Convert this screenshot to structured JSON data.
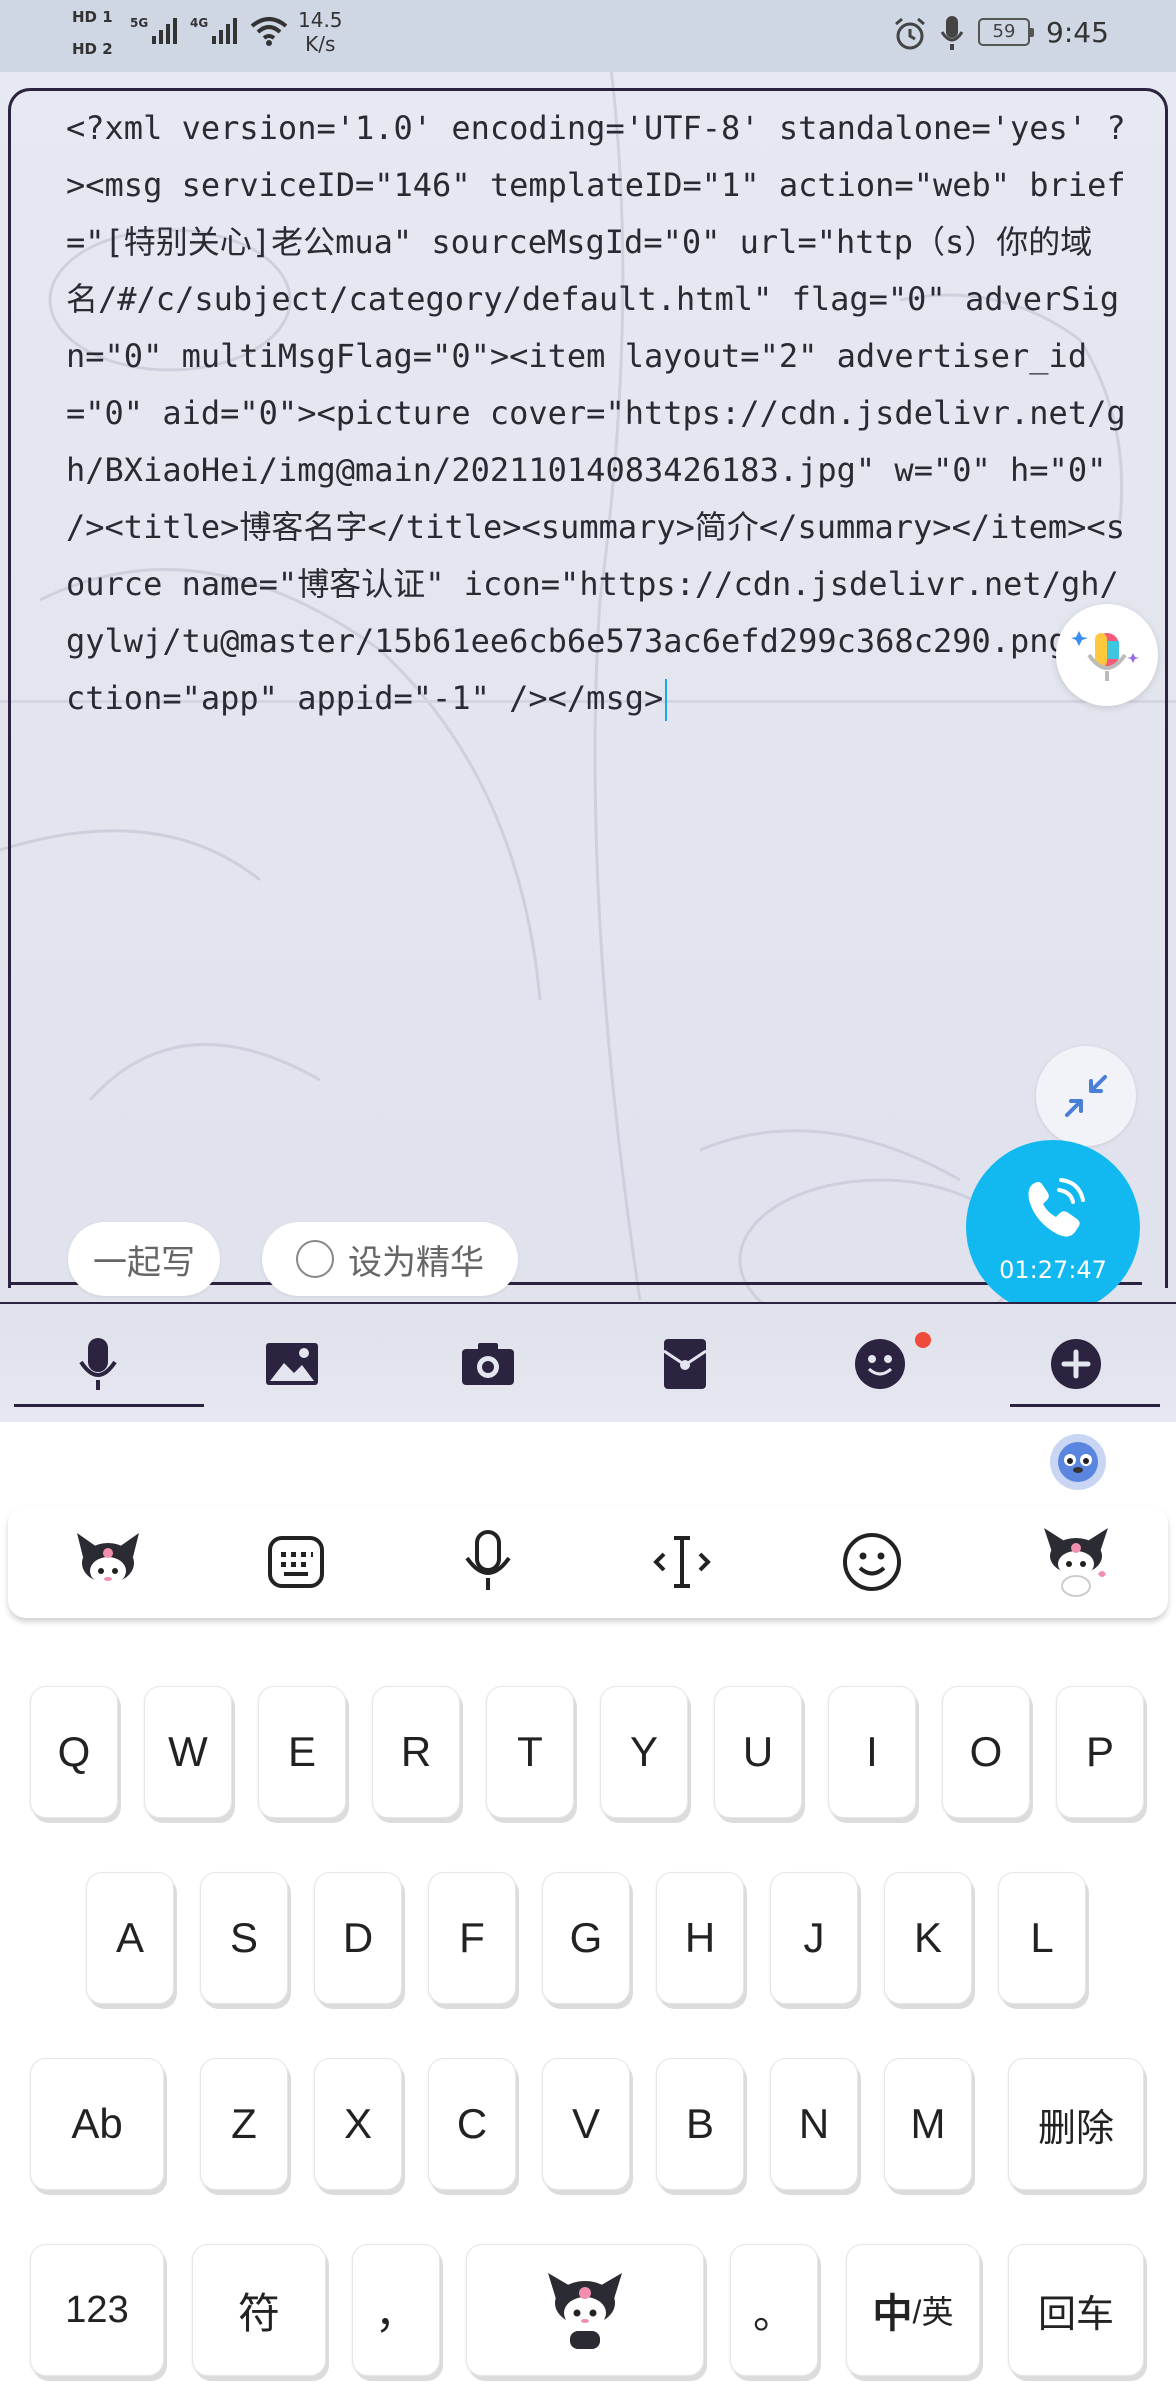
{
  "status_bar": {
    "hd1": "HD 1",
    "hd2": "HD 2",
    "sig1": "5G",
    "sig2": "4G",
    "net_speed_value": "14.5",
    "net_speed_unit": "K/s",
    "battery": "59",
    "time": "9:45"
  },
  "editor": {
    "text": "<?xml version='1.0' encoding='UTF-8' standalone='yes' ?><msg serviceID=\"146\" templateID=\"1\" action=\"web\" brief=\"[特别关心]老公mua\" sourceMsgId=\"0\" url=\"http（s）你的域名/#/c/subject/category/default.html\" flag=\"0\" adverSign=\"0\" multiMsgFlag=\"0\"><item layout=\"2\" advertiser_id=\"0\" aid=\"0\"><picture cover=\"https://cdn.jsdelivr.net/gh/BXiaoHei/img@main/20211014083426183.jpg\" w=\"0\" h=\"0\" /><title>博客名字</title><summary>简介</summary></item><source name=\"博客认证\" icon=\"https://cdn.jsdelivr.net/gh/gylwj/tu@master/15b61ee6cb6e573ac6efd299c368c290.png\" action=\"app\" appid=\"-1\" /></msg>"
  },
  "pills": {
    "together_write": "一起写",
    "set_featured": "设为精华"
  },
  "call": {
    "duration": "01:27:47"
  },
  "toolbar": {
    "icons": [
      "mic-icon",
      "image-icon",
      "camera-icon",
      "red-packet-icon",
      "emoji-icon",
      "plus-icon"
    ]
  },
  "keyboard": {
    "strip_icons": [
      "kuromi-sticker",
      "keyboard-icon",
      "mic-icon",
      "cursor-icon",
      "emoji-icon",
      "kuromi-sticker-2"
    ],
    "row1": [
      "Q",
      "W",
      "E",
      "R",
      "T",
      "Y",
      "U",
      "I",
      "O",
      "P"
    ],
    "row2": [
      "A",
      "S",
      "D",
      "F",
      "G",
      "H",
      "J",
      "K",
      "L"
    ],
    "row3_shift": "Ab",
    "row3": [
      "Z",
      "X",
      "C",
      "V",
      "B",
      "N",
      "M"
    ],
    "delete": "删除",
    "num": "123",
    "symbol": "符",
    "comma": "，",
    "period": "。",
    "lang_zh": "中",
    "lang_sep": "/英",
    "enter": "回车"
  },
  "colors": {
    "accent_blue": "#12b8f0",
    "frame_dark": "#2c2340",
    "notification_dot": "#f04a3a"
  }
}
